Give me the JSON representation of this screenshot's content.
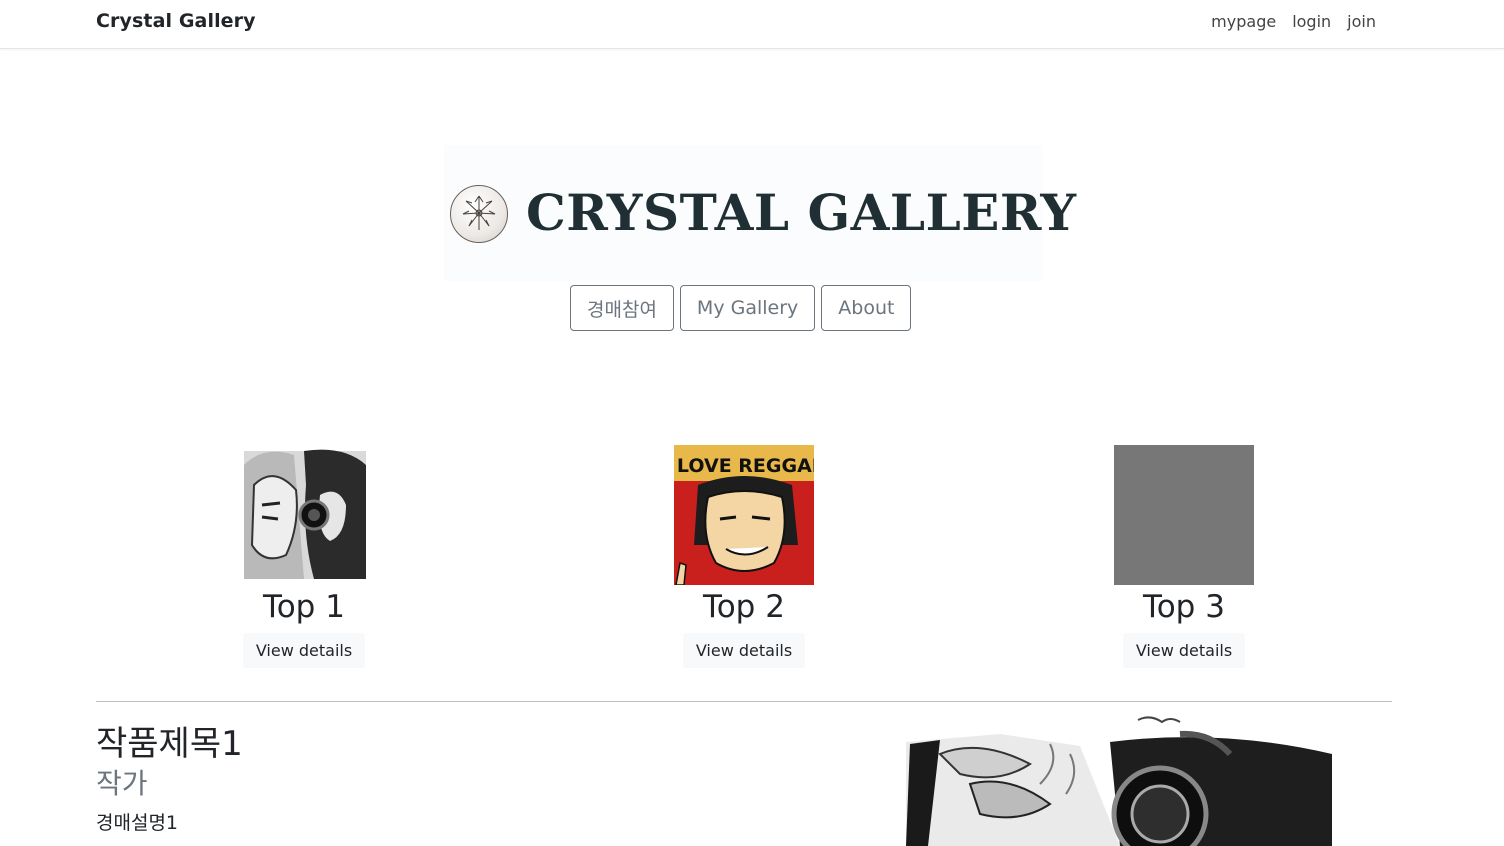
{
  "navbar": {
    "brand": "Crystal Gallery",
    "links": [
      "mypage",
      "login",
      "join"
    ]
  },
  "hero": {
    "title": "CRYSTAL GALLERY",
    "logo_icon": "crystal-flower-logo",
    "buttons": [
      "경매참여",
      "My Gallery",
      "About"
    ]
  },
  "top_items": [
    {
      "title": "Top 1",
      "button": "View details",
      "thumb": "sketch-portrait-image"
    },
    {
      "title": "Top 2",
      "button": "View details",
      "thumb": "i-love-reggae-image",
      "caption_text": "I LOVE REGGAE"
    },
    {
      "title": "Top 3",
      "button": "View details",
      "thumb": "placeholder-gray-image"
    }
  ],
  "featured": {
    "title": "작품제목1",
    "artist": "작가",
    "description": "경매설명1"
  },
  "colors": {
    "hero_title": "#1f2f33",
    "outline_button": "#6c757d",
    "placeholder": "#777777",
    "reggae_bg": "#c9201e",
    "reggae_banner": "#e8b84a"
  }
}
